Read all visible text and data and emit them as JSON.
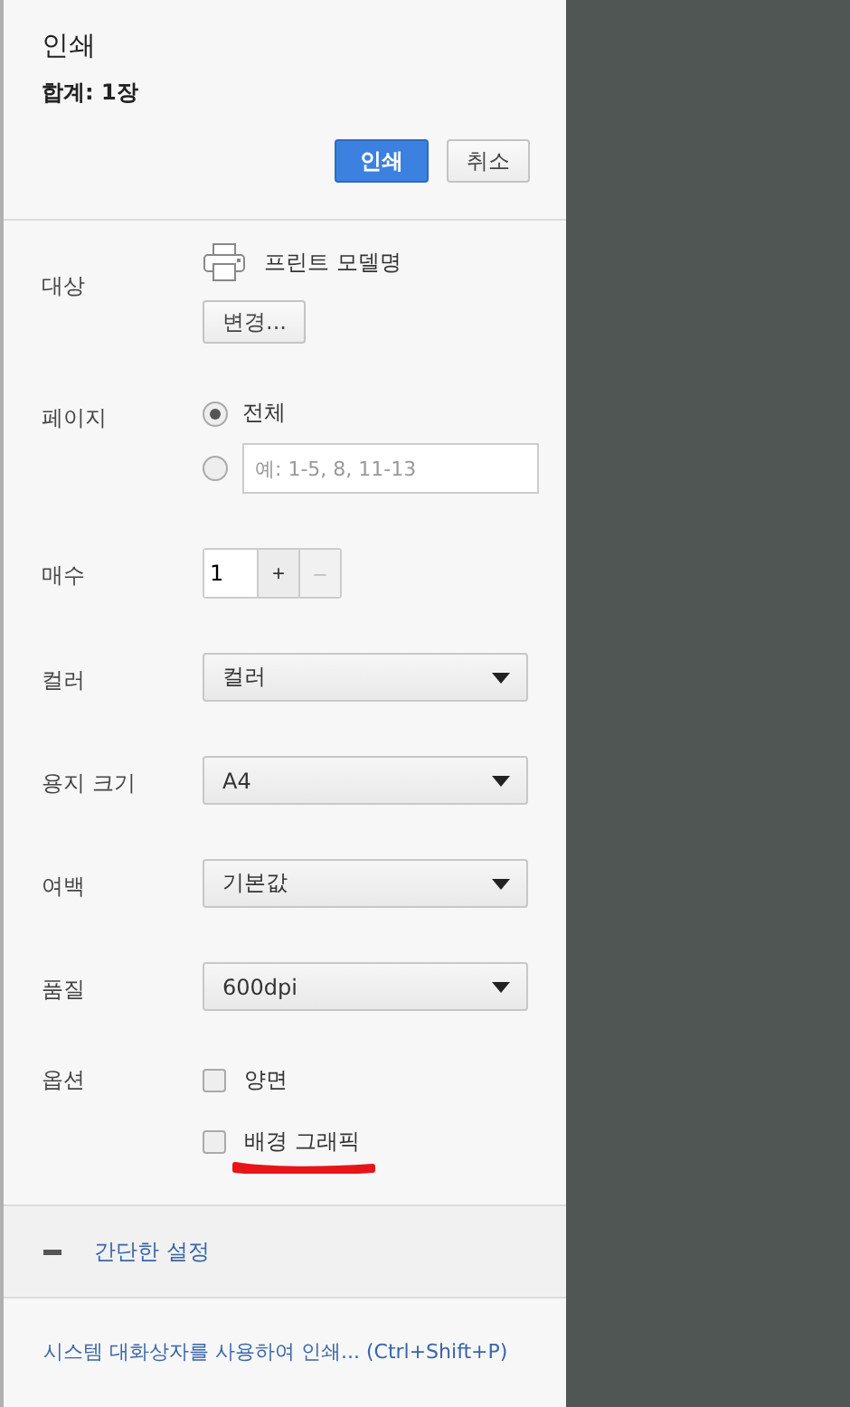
{
  "title": "인쇄",
  "summary": "합계: 1장",
  "buttons": [
    {
      "label": "인쇄",
      "kind": "primary"
    },
    {
      "label": "취소",
      "kind": "secondary"
    }
  ],
  "settings": [
    {
      "label": "대상",
      "kind": "printer",
      "printer": "프린트 모델명",
      "button": "변경..."
    },
    {
      "label": "페이지",
      "kind": "radio",
      "options": [
        {
          "label": "전체",
          "selected": true
        },
        {
          "placeholder": "예: 1-5, 8, 11-13",
          "selected": false
        }
      ]
    },
    {
      "label": "매수",
      "kind": "stepper",
      "value": "1",
      "plus": "+",
      "minus": "–",
      "minus_disabled": true
    },
    {
      "label": "컬러",
      "kind": "select",
      "value": "컬러"
    },
    {
      "label": "용지 크기",
      "kind": "select",
      "value": "A4"
    },
    {
      "label": "여백",
      "kind": "select",
      "value": "기본값"
    },
    {
      "label": "품질",
      "kind": "select",
      "value": "600dpi"
    },
    {
      "label": "옵션",
      "kind": "checkbox",
      "items": [
        {
          "label": "양면",
          "checked": false
        },
        {
          "label": "배경 그래픽",
          "checked": false
        }
      ]
    }
  ],
  "more_settings": {
    "label": "간단한 설정",
    "expanded": true
  },
  "system_dialog_link": "시스템 대화상자를 사용하여 인쇄... (Ctrl+Shift+P)"
}
